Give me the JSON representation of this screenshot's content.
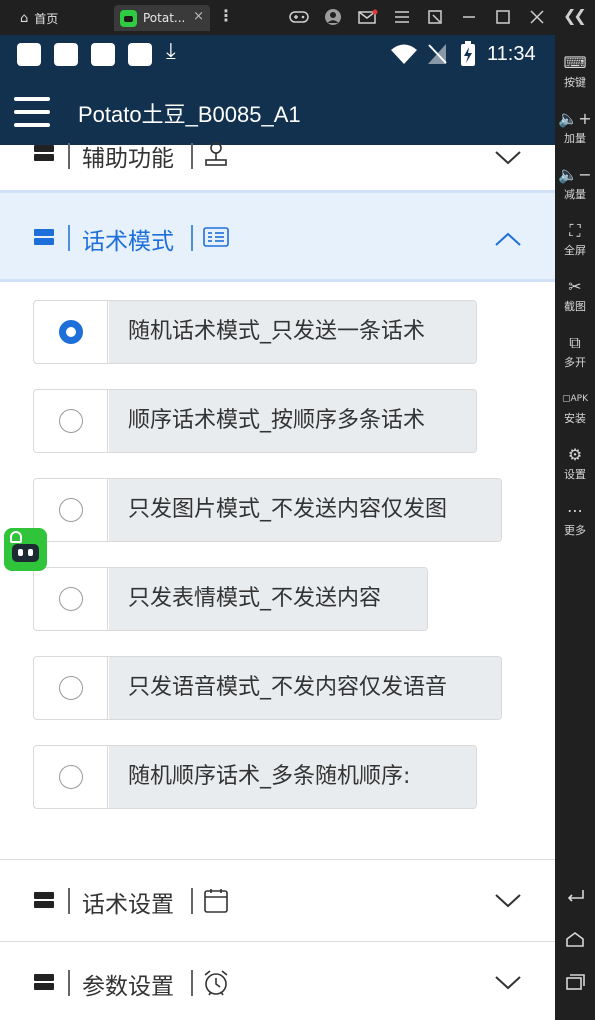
{
  "emulator": {
    "tab_home_label": "首页",
    "tab_app_label": "Potat...",
    "tab_close": "×",
    "sidebar": [
      {
        "icon": "keyboard-icon",
        "label": "按键"
      },
      {
        "icon": "volume-up-icon",
        "label": "加量"
      },
      {
        "icon": "volume-down-icon",
        "label": "减量"
      },
      {
        "icon": "fullscreen-icon",
        "label": "全屏"
      },
      {
        "icon": "scissors-icon",
        "label": "截图"
      },
      {
        "icon": "multi-open-icon",
        "label": "多开"
      },
      {
        "icon": "apk-install-icon",
        "label": "安装"
      },
      {
        "icon": "gear-icon",
        "label": "设置"
      },
      {
        "icon": "more-icon",
        "label": "更多"
      }
    ]
  },
  "statusbar": {
    "time": "11:34"
  },
  "appbar": {
    "title": "Potato土豆_B0085_A1"
  },
  "sections": {
    "assist": {
      "label": "辅助功能",
      "icon": "person-icon",
      "expanded": false
    },
    "script_mode": {
      "label": "话术模式",
      "icon": "id-card-icon",
      "expanded": true
    },
    "script_settings": {
      "label": "话术设置",
      "icon": "calendar-icon",
      "expanded": false
    },
    "param_settings": {
      "label": "参数设置",
      "icon": "alarm-clock-icon",
      "expanded": false
    }
  },
  "options": [
    {
      "label": "随机话术模式_只发送一条话术",
      "selected": true
    },
    {
      "label": "顺序话术模式_按顺序多条话术",
      "selected": false
    },
    {
      "label": "只发图片模式_不发送内容仅发图",
      "selected": false
    },
    {
      "label": "只发表情模式_不发送内容",
      "selected": false
    },
    {
      "label": "只发语音模式_不发内容仅发语音",
      "selected": false
    },
    {
      "label": "随机顺序话术_多条随机顺序:",
      "selected": false
    }
  ],
  "colors": {
    "accent": "#1e6fd9",
    "appbar": "#12314f",
    "active_section_bg": "#e7f1fc"
  }
}
